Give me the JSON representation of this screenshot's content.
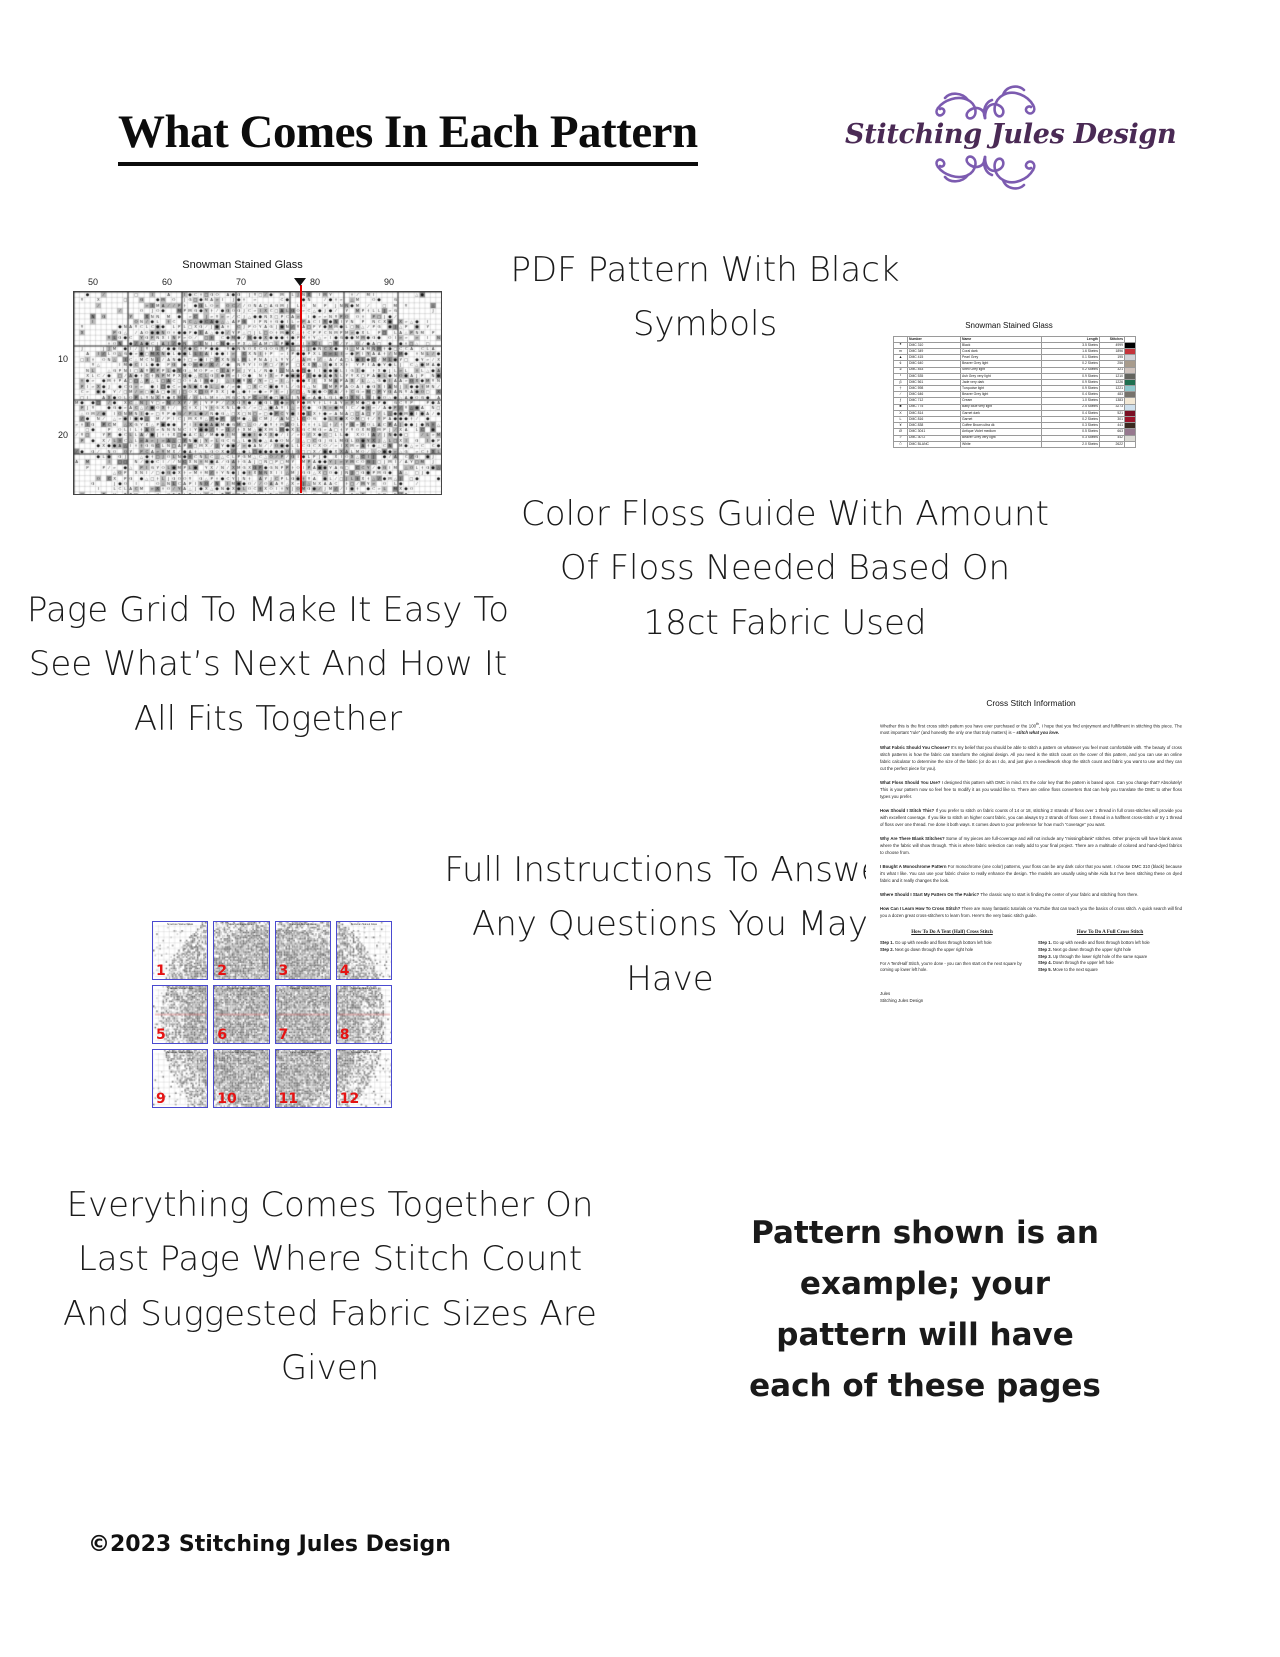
{
  "header": {
    "title": "What Comes In Each Pattern",
    "logo": {
      "brand": "Stitching Jules Design",
      "flourish_top": "❧☙❦",
      "flourish_bottom": "❦☙❧",
      "brand_color": "#4a2a55",
      "flourish_color": "#7c5bb0"
    }
  },
  "captions": {
    "pdf_pattern": "PDF Pattern With Black Symbols",
    "page_grid": "Page Grid To Make It Easy To See What’s Next And How It All Fits Together",
    "floss_guide": "Color Floss Guide With Amount Of Floss Needed Based On 18ct Fabric Used",
    "instructions": "Full Instructions To Answer Any Questions You May Have",
    "last_page": "Everything Comes Together On Last Page Where Stitch Count And Suggested Fabric Sizes Are Given",
    "example_note": "Pattern shown is an example; your pattern will have each of these pages"
  },
  "copyright": "©2023 Stitching Jules Design",
  "chart_preview": {
    "title": "Snowman Stained Glass",
    "column_ticks": [
      "50",
      "60",
      "70",
      "80",
      "90"
    ],
    "row_ticks": [
      "10",
      "20"
    ],
    "center_line_color": "#e60000",
    "grid_border_color": "#444444"
  },
  "floss_doc": {
    "title": "Snowman Stained Glass",
    "columns": [
      "",
      "Number",
      "Name",
      "Length",
      "Stitches",
      ""
    ],
    "rows": [
      {
        "symbol": "●",
        "number": "DMC   310",
        "name": "Black",
        "length": "3.5 Skeins",
        "stitches": "4999",
        "color": "#000000"
      },
      {
        "symbol": "m",
        "number": "DMC   349",
        "name": "Coral dark",
        "length": "1.6 Skeins",
        "stitches": "1896",
        "color": "#c4333a"
      },
      {
        "symbol": "▲",
        "number": "DMC   415",
        "name": "Pearl Grey",
        "length": "0.1 Skeins",
        "stitches": "195",
        "color": "#d2d3d7"
      },
      {
        "symbol": "¢",
        "number": "DMC   640",
        "name": "Beaver Grey light",
        "length": "0.2 Skeins",
        "stitches": "256",
        "color": "#a89c8d"
      },
      {
        "symbol": "ə",
        "number": "DMC   453",
        "name": "Shell Grey light",
        "length": "0.2 Skeins",
        "stitches": "321",
        "color": "#cfc3bd"
      },
      {
        "symbol": "I",
        "number": "DMC   535",
        "name": "Ash Grey very light",
        "length": "0.9 Skeins",
        "stitches": "1210",
        "color": "#63645e"
      },
      {
        "symbol": "β",
        "number": "DMC   561",
        "name": "Jade very dark",
        "length": "0.9 Skeins",
        "stitches": "1226",
        "color": "#1f6f4f"
      },
      {
        "symbol": "†",
        "number": "DMC   598",
        "name": "Turquoise light",
        "length": "0.9 Skeins",
        "stitches": "1221",
        "color": "#8fc9cd"
      },
      {
        "symbol": "⁄",
        "number": "DMC   646",
        "name": "Beaver Grey light",
        "length": "0.4 Skeins",
        "stitches": "483",
        "color": "#77736c"
      },
      {
        "symbol": "ƒ",
        "number": "DMC   712",
        "name": "Cream",
        "length": "1.0 Skeins",
        "stitches": "1383",
        "color": "#f2e8d5"
      },
      {
        "symbol": "■",
        "number": "DMC   775",
        "name": "Baby Blue very light",
        "length": "2.5 Skeins",
        "stitches": "3273",
        "color": "#cfe0ed"
      },
      {
        "symbol": "X",
        "number": "DMC   814",
        "name": "Garnet dark",
        "length": "0.4 Skeins",
        "stitches": "521",
        "color": "#7a0f23"
      },
      {
        "symbol": "L",
        "number": "DMC   816",
        "name": "Garnet",
        "length": "0.2 Skeins",
        "stitches": "301",
        "color": "#9b1329"
      },
      {
        "symbol": "¥",
        "number": "DMC   838",
        "name": "Coffee Brown ultra dk",
        "length": "0.3 Skeins",
        "stitches": "441",
        "color": "#3b2a20"
      },
      {
        "symbol": "Ø",
        "number": "DMC   3041",
        "name": "Antique Violet medium",
        "length": "0.5 Skeins",
        "stitches": "663",
        "color": "#97798f"
      },
      {
        "symbol": ">",
        "number": "DMC   3072",
        "name": "Beaver Grey very light",
        "length": "0.3 Skeins",
        "stitches": "442",
        "color": "#dcdcd6"
      },
      {
        "symbol": "△",
        "number": "DMC   BLANC",
        "name": "White",
        "length": "2.0 Skeins",
        "stitches": "2622",
        "color": "#ffffff"
      }
    ]
  },
  "page_grid": {
    "thumb_title": "Snowman Stained Glass",
    "thumbs": [
      "1",
      "2",
      "3",
      "4",
      "5",
      "6",
      "7",
      "8",
      "9",
      "10",
      "11",
      "12"
    ],
    "border_color": "#4a4ad0",
    "number_color": "#e51313"
  },
  "instructions_doc": {
    "heading": "Cross Stitch Information",
    "intro": "Whether this is the first cross stitch pattern you have ever purchased or the 100<sup>th</sup>, I hope that you find enjoyment and fulfillment in stitching this piece. The most important “rule” (and honestly the only one that truly matters) is – <i>stitch what you love.</i>",
    "paragraphs": [
      {
        "lead": "What Fabric Should You Choose?",
        "body": " It’s my belief that you should be able to stitch a pattern on whatever you feel most comfortable with. The beauty of cross stitch patterns is how the fabric can transform the original design.  All you need is the stitch count on the cover of this pattern, and you can use an online fabric calculator to determine the size of the fabric (or do as I do, and just give a needlework shop the stitch count and fabric you want to use and they can cut the perfect piece for you)."
      },
      {
        "lead": "What Floss Should You Use?",
        "body": " I designed this pattern with DMC in mind. It’s the color key that the pattern is based upon. Can you change that? Absolutely! This is your pattern now so feel free to modify it as you would like to.  There are online floss converters that can help you translate the DMC to other floss types you prefer."
      },
      {
        "lead": "How Should I Stitch This?",
        "body": " If you prefer to stitch on fabric counts of 14 or 18, stitching 2 strands of floss over 1 thread in full cross-stitches will provide you with excellent coverage. If you like to stitch on higher count fabric, you can always try 2 strands of floss over 1 thread in a half/tent cross-stitch or try 1 thread of floss over one thread. I’ve done it both ways. It comes down to your preference for how much “coverage” you want."
      },
      {
        "lead": "Why Are There Blank Stitches?",
        "body": " Some of my pieces are full-coverage and will not include any “missing/blank” stitches. Other projects will have blank areas where the fabric will show through. This is where fabric selection can really add to your final project. There are a multitude of colored and hand-dyed fabrics to choose from."
      },
      {
        "lead": "I Bought A Monochrome Pattern",
        "body": " For monochrome (one color) patterns, your floss can be any dark color that you want. I choose DMC 310 (black) because it’s what I like. You can use your fabric choice to really enhance the design. The models are usually using white Aida but I’ve been stitching these on dyed fabric and it really changes the look."
      },
      {
        "lead": "Where Should I Start My Pattern On The Fabric?",
        "body": " The classic way to start is finding the center of your fabric and stitching from there."
      },
      {
        "lead": "How Can I Learn How To Cross Stitch?",
        "body": " There are many fantastic tutorials on YouTube that can teach you the basics of cross stitch. A quick search will find you a dozen great cross-stitchers to learn from. Here’s the very basic stitch guide."
      }
    ],
    "tent_column": {
      "heading": "How To Do A Tent (Half) Cross Stitch",
      "steps": [
        {
          "label": "Step 1.",
          "text": " Go up with needle and floss through bottom left hole"
        },
        {
          "label": "Step 2.",
          "text": " Next go down through the upper right hole"
        }
      ],
      "note": "For A Tent/Half Stitch, you’re done - you can then start on the next square by coming up lower left hole."
    },
    "full_column": {
      "heading": "How To Do A Full Cross Stitch",
      "steps": [
        {
          "label": "Step 1.",
          "text": " Go up with needle and floss through bottom left hole"
        },
        {
          "label": "Step 2.",
          "text": " Next go down through the upper right hole"
        },
        {
          "label": "Step 3.",
          "text": " Up through the lower right hole of the same square"
        },
        {
          "label": "Step 4.",
          "text": " Down through the upper left hole"
        },
        {
          "label": "Step 5.",
          "text": " Move to the next square"
        }
      ]
    },
    "signature_name": "Jules",
    "signature_brand": "Stitching Jules Design"
  }
}
